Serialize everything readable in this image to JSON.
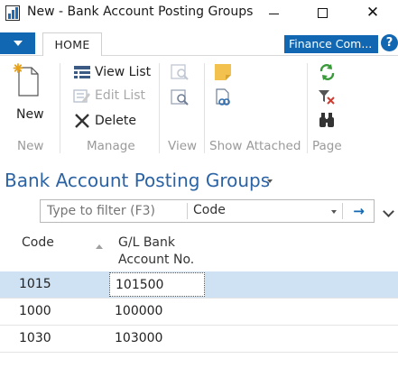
{
  "window": {
    "title": "New - Bank Account Posting Groups"
  },
  "ribbon": {
    "tab_home": "HOME",
    "company_badge": "Finance Com...",
    "help_label": "?",
    "new_label": "New",
    "view_list_label": "View List",
    "edit_list_label": "Edit List",
    "delete_label": "Delete",
    "groups": {
      "new": "New",
      "manage": "Manage",
      "view": "View",
      "show_attached": "Show Attached",
      "page": "Page"
    }
  },
  "page": {
    "title": "Bank Account Posting Groups"
  },
  "filter": {
    "placeholder": "Type to filter (F3)",
    "value": "",
    "field": "Code",
    "go_label": "→"
  },
  "grid": {
    "columns": {
      "code": "Code",
      "gl_line1": "G/L Bank",
      "gl_line2": "Account No."
    },
    "rows": [
      {
        "code": "1015",
        "account": "101500"
      },
      {
        "code": "1000",
        "account": "100000"
      },
      {
        "code": "1030",
        "account": "103000"
      }
    ]
  },
  "colors": {
    "accent": "#1167b1",
    "title_blue": "#2b63a5",
    "selected_row": "#cfe2f3",
    "group_label": "#9a9a9a"
  }
}
